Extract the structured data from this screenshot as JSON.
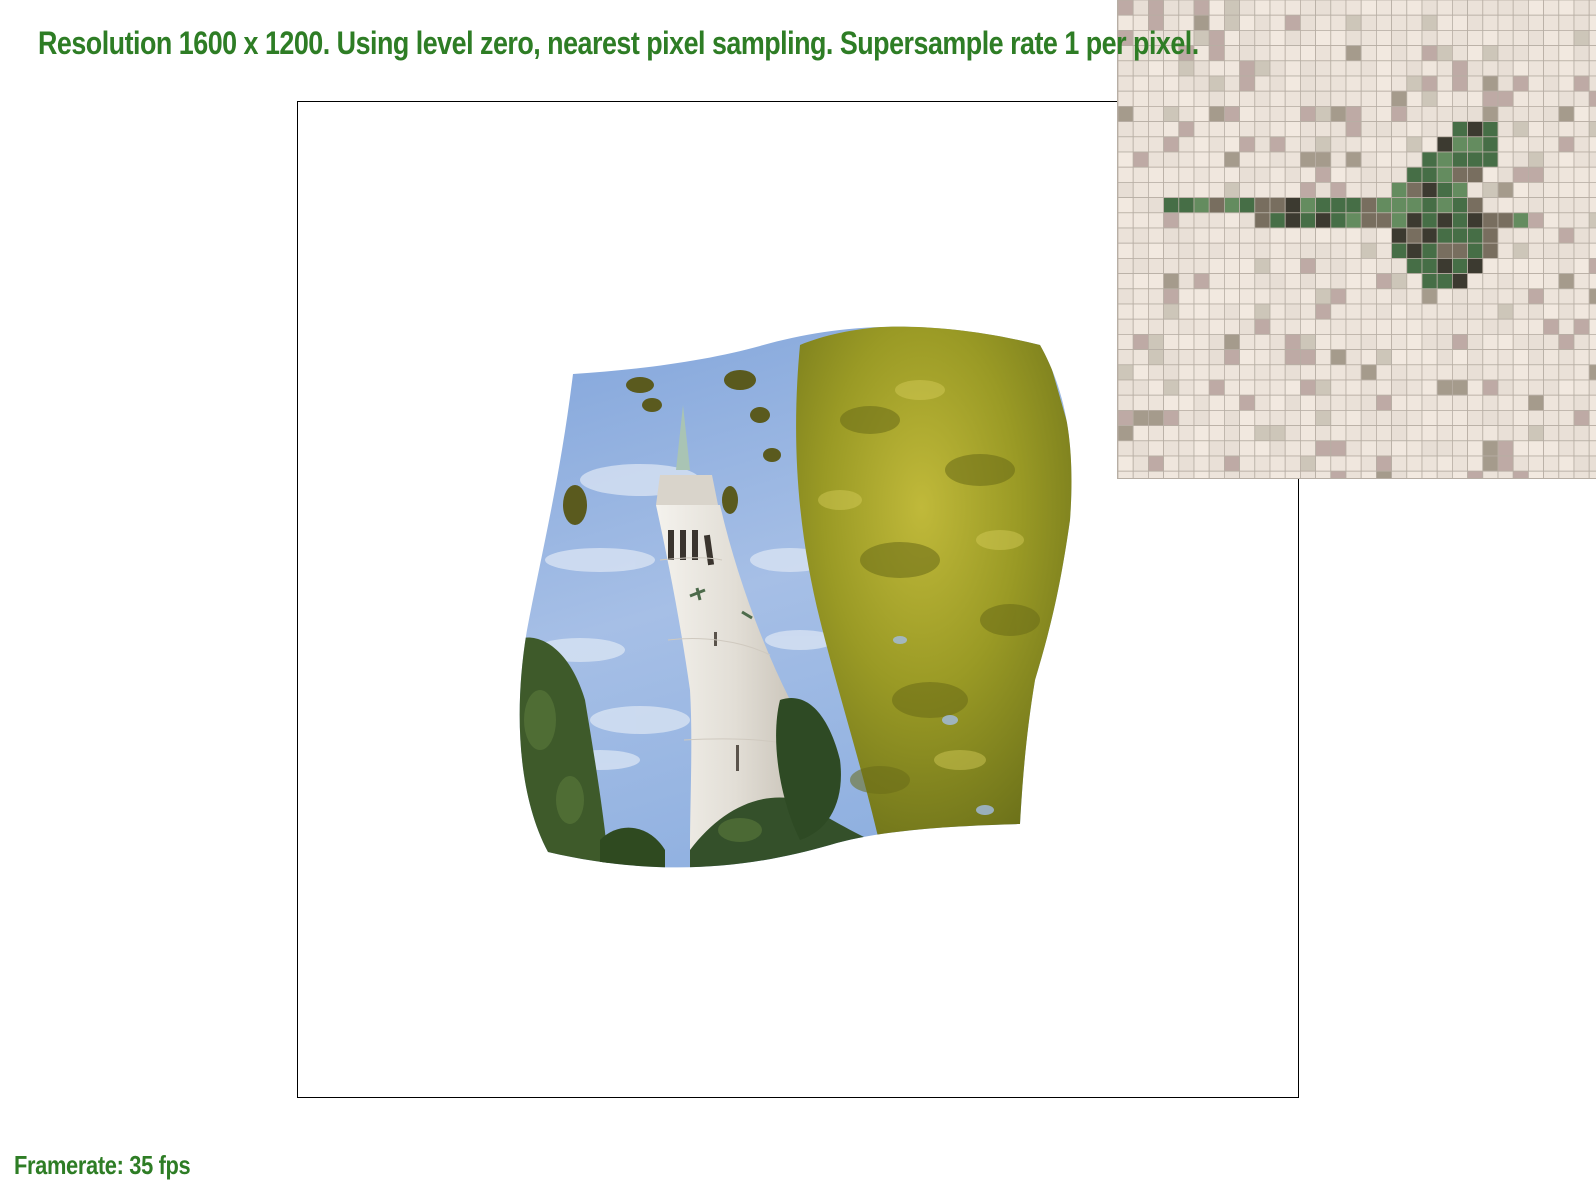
{
  "status": {
    "resolution_line": "Resolution 1600 x 1200. Using level zero, nearest pixel sampling. Supersample rate 1 per pixel."
  },
  "footer": {
    "framerate": "Framerate: 35 fps"
  },
  "colors": {
    "status_text": "#2e7d25",
    "frame_border": "#000000",
    "sky": "#7a9fd6",
    "tower_stone": "#e7e3db",
    "foliage_light": "#a7a834",
    "foliage_dark": "#3f5e2c",
    "zoom_background": "#ece3da",
    "zoom_grid": "#b7aea4"
  },
  "zoom": {
    "sampling": "nearest",
    "subject": "leaf-twig"
  }
}
